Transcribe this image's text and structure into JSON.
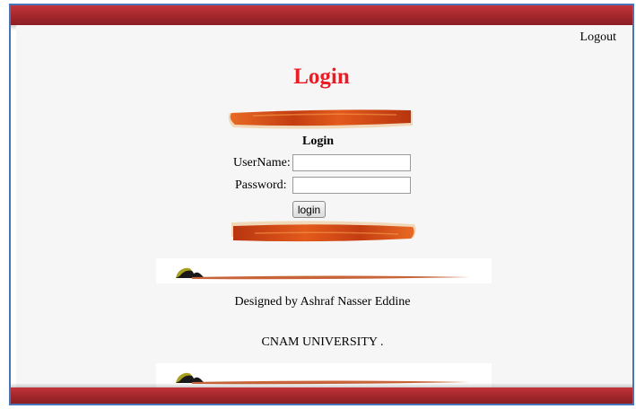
{
  "header": {
    "logout_label": "Logout"
  },
  "main": {
    "title": "Login",
    "form": {
      "heading": "Login",
      "username_label": "UserName:",
      "username_value": "",
      "password_label": "Password:",
      "password_value": "",
      "submit_label": "login"
    }
  },
  "footer": {
    "credit": "Designed by Ashraf Nasser Eddine",
    "institution": "CNAM UNIVERSITY ."
  },
  "colors": {
    "bar": "#a3272b",
    "title": "#ec1c24",
    "frame_border": "#4a74b8",
    "ribbon": "#d9531a"
  }
}
